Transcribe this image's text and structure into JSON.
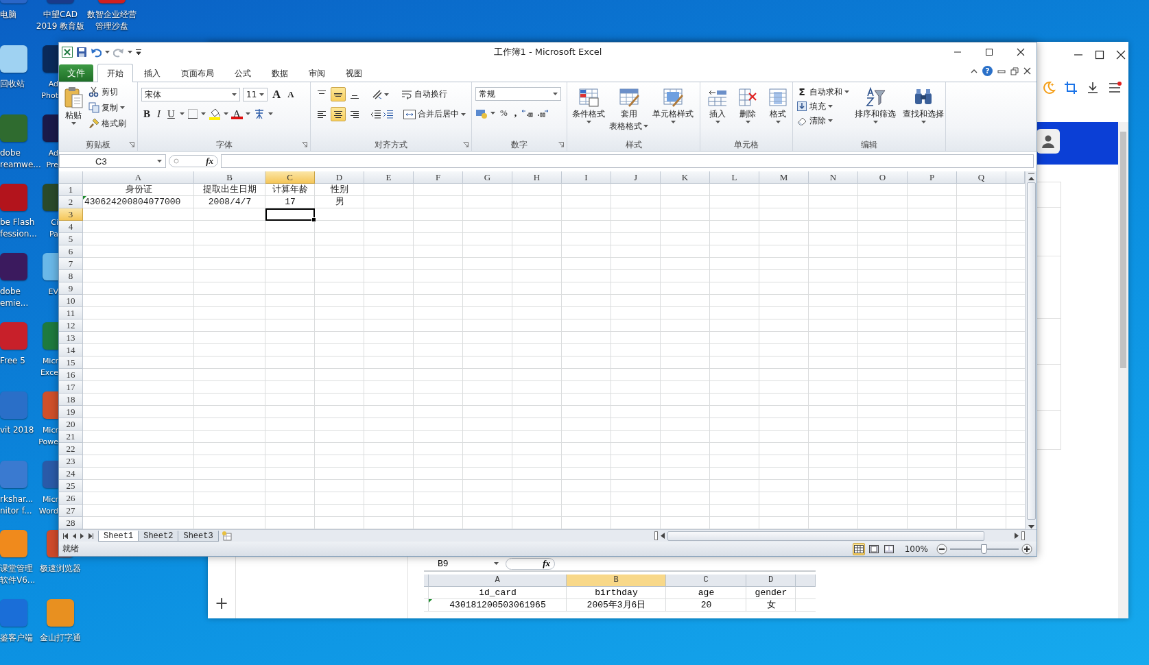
{
  "desktop_columns": [
    {
      "icons": [
        {
          "lines": [
            "电脑"
          ],
          "color": "#2a66c8",
          "kind": "full"
        },
        {
          "lines": [
            "回收站"
          ],
          "color": "#9fd2f2",
          "kind": "full"
        },
        {
          "lines": [
            "dobe",
            "reamwe..."
          ],
          "color": "#2f6b2f",
          "kind": "full"
        },
        {
          "lines": [
            "be Flash",
            "fession..."
          ],
          "color": "#b3141c",
          "kind": "full"
        },
        {
          "lines": [
            "dobe",
            "emie..."
          ],
          "color": "#3b1a5e",
          "kind": "full"
        },
        {
          "lines": [
            "Free 5"
          ],
          "color": "#c8202a",
          "kind": "full"
        },
        {
          "lines": [
            "vit 2018"
          ],
          "color": "#2a6fc8",
          "kind": "full"
        },
        {
          "lines": [
            "rkshar...",
            "nitor f..."
          ],
          "color": "#3a7ad0",
          "kind": "full"
        },
        {
          "lines": [
            "课堂管理",
            "软件V6..."
          ],
          "color": "#f08a1c",
          "kind": "full"
        },
        {
          "lines": [
            "鉴客户端"
          ],
          "color": "#1a6ed8",
          "kind": "full"
        }
      ]
    },
    {
      "icons": [
        {
          "lines": [
            "中望CAD",
            "2019 教育版"
          ],
          "color": "#1a3a8a",
          "kind": "full"
        },
        {
          "lines": [
            "Ad",
            "Phot"
          ],
          "color": "#0a2a5a",
          "kind": "partial"
        },
        {
          "lines": [
            "Ad",
            "Pre"
          ],
          "color": "#1a1a4a",
          "kind": "partial"
        },
        {
          "lines": [
            "Ci",
            "Pa"
          ],
          "color": "#2a4a2a",
          "kind": "partial"
        },
        {
          "lines": [
            "EV"
          ],
          "color": "#6ab8e8",
          "kind": "partial"
        },
        {
          "lines": [
            "Micr",
            "Exce"
          ],
          "color": "#1e7a3e",
          "kind": "partial"
        },
        {
          "lines": [
            "Micr",
            "Powe"
          ],
          "color": "#d0502a",
          "kind": "partial"
        },
        {
          "lines": [
            "Micr",
            "Word"
          ],
          "color": "#2a5aa8",
          "kind": "partial"
        },
        {
          "lines": [
            "极速浏览器"
          ],
          "color": "#d04a2a",
          "kind": "full"
        },
        {
          "lines": [
            "金山打字通"
          ],
          "color": "#e89020",
          "kind": "full"
        }
      ]
    },
    {
      "icons": [
        {
          "lines": [
            "数智企业经营",
            "管理沙盘"
          ],
          "color": "#d02020",
          "kind": "full"
        }
      ]
    }
  ],
  "browser": {
    "add_label": "+",
    "sheet": {
      "name_box": "B9",
      "function_label": "fx",
      "columns": [
        {
          "label": "A",
          "selected": false
        },
        {
          "label": "B",
          "selected": true
        },
        {
          "label": "C",
          "selected": false
        },
        {
          "label": "D",
          "selected": false
        }
      ],
      "rows": [
        {
          "cells": [
            {
              "text": "id_card",
              "flag": false
            },
            {
              "text": "birthday",
              "flag": false
            },
            {
              "text": "age",
              "flag": false
            },
            {
              "text": "gender",
              "flag": false
            }
          ]
        },
        {
          "cells": [
            {
              "text": "430181200503061965",
              "flag": true
            },
            {
              "text": "2005年3月6日",
              "flag": false
            },
            {
              "text": "20",
              "flag": false
            },
            {
              "text": "女",
              "flag": false
            }
          ]
        }
      ]
    }
  },
  "excel": {
    "title": "工作簿1 - Microsoft Excel",
    "file_tab": "文件",
    "help_label": "?",
    "tabs": [
      {
        "label": "开始",
        "selected": true
      },
      {
        "label": "插入",
        "selected": false
      },
      {
        "label": "页面布局",
        "selected": false
      },
      {
        "label": "公式",
        "selected": false
      },
      {
        "label": "数据",
        "selected": false
      },
      {
        "label": "审阅",
        "selected": false
      },
      {
        "label": "视图",
        "selected": false
      }
    ],
    "ribbon": {
      "clipboard": {
        "label": "剪贴板",
        "paste": "粘贴",
        "cut": "剪切",
        "copy": "复制",
        "painter": "格式刷"
      },
      "font": {
        "label": "字体",
        "name": "宋体",
        "size": "11",
        "grow": "A",
        "shrink": "A",
        "bold": "B",
        "italic": "I",
        "underline": "U",
        "color_letter": "A"
      },
      "alignment": {
        "label": "对齐方式",
        "wrap": "自动换行",
        "merge": "合并后居中",
        "vertical": [
          {
            "kind": "top",
            "selected": false
          },
          {
            "kind": "middle",
            "selected": true
          },
          {
            "kind": "bottom",
            "selected": false
          }
        ],
        "horizontal": [
          {
            "kind": "left",
            "selected": false
          },
          {
            "kind": "center",
            "selected": true
          },
          {
            "kind": "right",
            "selected": false
          }
        ]
      },
      "number": {
        "label": "数字",
        "format": "常规",
        "percent": "%",
        "comma": ","
      },
      "styles": {
        "label": "样式",
        "buttons": [
          {
            "lines": [
              "条件格式"
            ],
            "kind": "conditional"
          },
          {
            "lines": [
              "套用",
              "表格格式"
            ],
            "kind": "table"
          },
          {
            "lines": [
              "单元格样式"
            ],
            "kind": "cell"
          }
        ]
      },
      "cells": {
        "label": "单元格",
        "buttons": [
          {
            "label": "插入",
            "kind": "insert"
          },
          {
            "label": "删除",
            "kind": "delete"
          },
          {
            "label": "格式",
            "kind": "format"
          }
        ]
      },
      "editing": {
        "label": "编辑",
        "sum_symbol": "Σ",
        "small": [
          {
            "label": "自动求和",
            "kind": "sum"
          },
          {
            "label": "填充",
            "kind": "fill"
          },
          {
            "label": "清除",
            "kind": "clear"
          }
        ],
        "buttons": [
          {
            "lines": [
              "排序和筛选"
            ],
            "kind": "sort"
          },
          {
            "lines": [
              "查找和选择"
            ],
            "kind": "find"
          }
        ]
      }
    },
    "formula_bar": {
      "name_box": "C3",
      "function_label": "fx"
    },
    "grid": {
      "columns": [
        {
          "label": "A",
          "selected": false
        },
        {
          "label": "B",
          "selected": false
        },
        {
          "label": "C",
          "selected": true
        },
        {
          "label": "D",
          "selected": false
        },
        {
          "label": "E",
          "selected": false
        },
        {
          "label": "F",
          "selected": false
        },
        {
          "label": "G",
          "selected": false
        },
        {
          "label": "H",
          "selected": false
        },
        {
          "label": "I",
          "selected": false
        },
        {
          "label": "J",
          "selected": false
        },
        {
          "label": "K",
          "selected": false
        },
        {
          "label": "L",
          "selected": false
        },
        {
          "label": "M",
          "selected": false
        },
        {
          "label": "N",
          "selected": false
        },
        {
          "label": "O",
          "selected": false
        },
        {
          "label": "P",
          "selected": false
        },
        {
          "label": "Q",
          "selected": false
        }
      ],
      "rows": [
        {
          "label": "1",
          "selected": false
        },
        {
          "label": "2",
          "selected": false
        },
        {
          "label": "3",
          "selected": true
        },
        {
          "label": "4",
          "selected": false
        },
        {
          "label": "5",
          "selected": false
        },
        {
          "label": "6",
          "selected": false
        },
        {
          "label": "7",
          "selected": false
        },
        {
          "label": "8",
          "selected": false
        },
        {
          "label": "9",
          "selected": false
        },
        {
          "label": "10",
          "selected": false
        },
        {
          "label": "11",
          "selected": false
        },
        {
          "label": "12",
          "selected": false
        },
        {
          "label": "13",
          "selected": false
        },
        {
          "label": "14",
          "selected": false
        },
        {
          "label": "15",
          "selected": false
        },
        {
          "label": "16",
          "selected": false
        },
        {
          "label": "17",
          "selected": false
        },
        {
          "label": "18",
          "selected": false
        },
        {
          "label": "19",
          "selected": false
        },
        {
          "label": "20",
          "selected": false
        },
        {
          "label": "21",
          "selected": false
        },
        {
          "label": "22",
          "selected": false
        },
        {
          "label": "23",
          "selected": false
        },
        {
          "label": "24",
          "selected": false
        },
        {
          "label": "25",
          "selected": false
        },
        {
          "label": "26",
          "selected": false
        },
        {
          "label": "27",
          "selected": false
        },
        {
          "label": "28",
          "selected": false
        }
      ],
      "data": [
        {
          "cells": [
            {
              "text": "身份证",
              "flag": false
            },
            {
              "text": "提取出生日期",
              "flag": false
            },
            {
              "text": "计算年龄",
              "flag": false
            },
            {
              "text": "性别",
              "flag": false
            }
          ]
        },
        {
          "cells": [
            {
              "text": "430624200804077000",
              "flag": true
            },
            {
              "text": "2008/4/7",
              "flag": false
            },
            {
              "text": "17",
              "flag": false
            },
            {
              "text": "男",
              "flag": false
            }
          ]
        }
      ]
    },
    "sheet_tabs": [
      {
        "label": "Sheet1",
        "selected": true
      },
      {
        "label": "Sheet2",
        "selected": false
      },
      {
        "label": "Sheet3",
        "selected": false
      }
    ],
    "status": "就绪",
    "views": [
      {
        "kind": "normal",
        "selected": true
      },
      {
        "kind": "layout",
        "selected": false
      },
      {
        "kind": "break",
        "selected": false
      }
    ],
    "zoom": {
      "reading": "100%",
      "level": 0.5
    }
  }
}
